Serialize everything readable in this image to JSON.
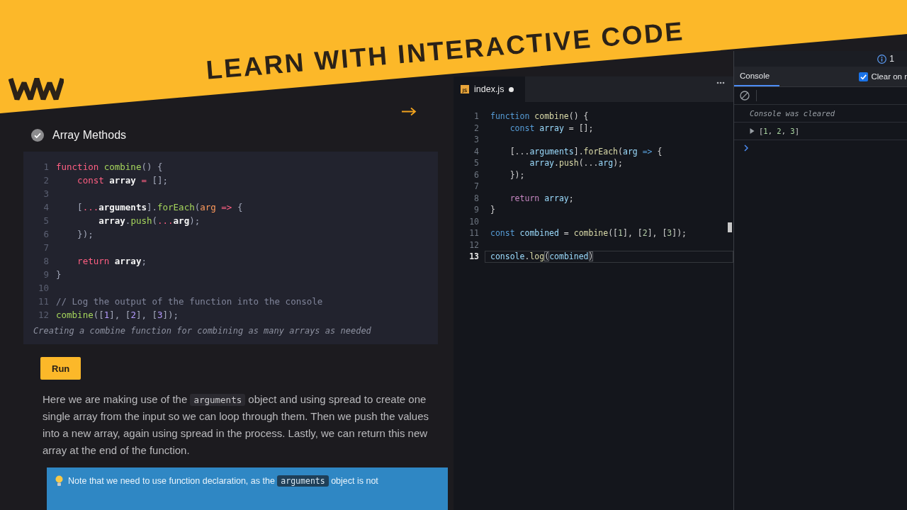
{
  "banner": {
    "title": "LEARN WITH INTERACTIVE CODE"
  },
  "lesson": {
    "title": "Array Methods",
    "completed": true,
    "code": {
      "lines": [
        {
          "number": "1",
          "tokens": [
            {
              "text": "function ",
              "kind": "keyword"
            },
            {
              "text": "combine",
              "kind": "function"
            },
            {
              "text": "() {",
              "kind": "punct"
            }
          ]
        },
        {
          "number": "2",
          "tokens": [
            {
              "text": "    const ",
              "kind": "keyword"
            },
            {
              "text": "array",
              "kind": "variable"
            },
            {
              "text": " = ",
              "kind": "operator"
            },
            {
              "text": "[];",
              "kind": "punct"
            }
          ]
        },
        {
          "number": "3"
        },
        {
          "number": "4",
          "tokens": [
            {
              "text": "    [",
              "kind": "punct"
            },
            {
              "text": "...",
              "kind": "operator"
            },
            {
              "text": "arguments",
              "kind": "variable"
            },
            {
              "text": "].",
              "kind": "punct"
            },
            {
              "text": "forEach",
              "kind": "function"
            },
            {
              "text": "(",
              "kind": "punct"
            },
            {
              "text": "arg",
              "kind": "param"
            },
            {
              "text": " => ",
              "kind": "operator"
            },
            {
              "text": "{",
              "kind": "punct"
            }
          ]
        },
        {
          "number": "5",
          "tokens": [
            {
              "text": "        array",
              "kind": "variable"
            },
            {
              "text": ".",
              "kind": "punct"
            },
            {
              "text": "push",
              "kind": "function"
            },
            {
              "text": "(",
              "kind": "punct"
            },
            {
              "text": "...",
              "kind": "operator"
            },
            {
              "text": "arg",
              "kind": "variable"
            },
            {
              "text": ");",
              "kind": "punct"
            }
          ]
        },
        {
          "number": "6",
          "tokens": [
            {
              "text": "    });",
              "kind": "punct"
            }
          ]
        },
        {
          "number": "7"
        },
        {
          "number": "8",
          "tokens": [
            {
              "text": "    return ",
              "kind": "keyword"
            },
            {
              "text": "array",
              "kind": "variable"
            },
            {
              "text": ";",
              "kind": "punct"
            }
          ]
        },
        {
          "number": "9",
          "tokens": [
            {
              "text": "}",
              "kind": "punct"
            }
          ]
        },
        {
          "number": "10"
        },
        {
          "number": "11",
          "tokens": [
            {
              "text": "// Log the output of the function into the console",
              "kind": "comment"
            }
          ]
        },
        {
          "number": "12",
          "tokens": [
            {
              "text": "combine",
              "kind": "function"
            },
            {
              "text": "([",
              "kind": "punct"
            },
            {
              "text": "1",
              "kind": "number"
            },
            {
              "text": "], [",
              "kind": "punct"
            },
            {
              "text": "2",
              "kind": "number"
            },
            {
              "text": "], [",
              "kind": "punct"
            },
            {
              "text": "3",
              "kind": "number"
            },
            {
              "text": "]);",
              "kind": "punct"
            }
          ]
        }
      ],
      "caption": "Creating a combine function for combining as many arrays as needed"
    },
    "run_button": "Run",
    "paragraph": [
      {
        "text": "Here we are making use of the ",
        "kind": "text"
      },
      {
        "text": "arguments",
        "kind": "code"
      },
      {
        "text": " object and using spread to create one single array from the input so we can loop through them. Then we push the values into a new array, again using spread in the process. Lastly, we can return this new array at the end of the function.",
        "kind": "text"
      }
    ],
    "note": [
      {
        "text": "Note that we need to use function declaration, as the ",
        "kind": "text"
      },
      {
        "text": "arguments",
        "kind": "code"
      },
      {
        "text": " object is not",
        "kind": "text"
      }
    ]
  },
  "editor": {
    "tabs": [
      {
        "label": "index.js",
        "badge": "JS",
        "selected": true,
        "modified": true
      }
    ],
    "lines": [
      {
        "number": "1",
        "current": false,
        "tokens": [
          {
            "text": "function ",
            "kind": "keyword"
          },
          {
            "text": "combine",
            "kind": "function"
          },
          {
            "text": "() {",
            "kind": "punct"
          }
        ]
      },
      {
        "number": "2",
        "current": false,
        "tokens": [
          {
            "text": "    const ",
            "kind": "keyword"
          },
          {
            "text": "array",
            "kind": "variable"
          },
          {
            "text": " = [];",
            "kind": "punct"
          }
        ]
      },
      {
        "number": "3",
        "current": false
      },
      {
        "number": "4",
        "current": false,
        "tokens": [
          {
            "text": "    [...",
            "kind": "punct"
          },
          {
            "text": "arguments",
            "kind": "variable"
          },
          {
            "text": "].",
            "kind": "punct"
          },
          {
            "text": "forEach",
            "kind": "function"
          },
          {
            "text": "(",
            "kind": "punct"
          },
          {
            "text": "arg",
            "kind": "variable"
          },
          {
            "text": " => ",
            "kind": "keyword"
          },
          {
            "text": "{",
            "kind": "punct"
          }
        ]
      },
      {
        "number": "5",
        "current": false,
        "tokens": [
          {
            "text": "        array",
            "kind": "variable"
          },
          {
            "text": ".",
            "kind": "punct"
          },
          {
            "text": "push",
            "kind": "function"
          },
          {
            "text": "(...",
            "kind": "punct"
          },
          {
            "text": "arg",
            "kind": "variable"
          },
          {
            "text": ");",
            "kind": "punct"
          }
        ]
      },
      {
        "number": "6",
        "current": false,
        "tokens": [
          {
            "text": "    });",
            "kind": "punct"
          }
        ]
      },
      {
        "number": "7",
        "current": false
      },
      {
        "number": "8",
        "current": false,
        "tokens": [
          {
            "text": "    return ",
            "kind": "control"
          },
          {
            "text": "array",
            "kind": "variable"
          },
          {
            "text": ";",
            "kind": "punct"
          }
        ]
      },
      {
        "number": "9",
        "current": false,
        "tokens": [
          {
            "text": "}",
            "kind": "punct"
          }
        ]
      },
      {
        "number": "10",
        "current": false
      },
      {
        "number": "11",
        "current": false,
        "tokens": [
          {
            "text": "const ",
            "kind": "keyword"
          },
          {
            "text": "combined",
            "kind": "variable"
          },
          {
            "text": " = ",
            "kind": "punct"
          },
          {
            "text": "combine",
            "kind": "function"
          },
          {
            "text": "([",
            "kind": "punct"
          },
          {
            "text": "1",
            "kind": "number"
          },
          {
            "text": "], [",
            "kind": "punct"
          },
          {
            "text": "2",
            "kind": "number"
          },
          {
            "text": "], [",
            "kind": "punct"
          },
          {
            "text": "3",
            "kind": "number"
          },
          {
            "text": "]);",
            "kind": "punct"
          }
        ]
      },
      {
        "number": "12",
        "current": false
      },
      {
        "number": "13",
        "current": true,
        "tokens": [
          {
            "text": "console",
            "kind": "variable"
          },
          {
            "text": ".",
            "kind": "punct"
          },
          {
            "text": "log",
            "kind": "function"
          },
          {
            "text": "(",
            "kind": "bracket"
          },
          {
            "text": "combined",
            "kind": "variable"
          },
          {
            "text": ")",
            "kind": "bracket"
          }
        ]
      }
    ]
  },
  "console": {
    "info_count": "1",
    "tabs": [
      {
        "label": "Console",
        "selected": true
      }
    ],
    "clear_option": {
      "label": "Clear on r",
      "checked": true
    },
    "messages": [
      {
        "kind": "info",
        "text": "Console was cleared"
      },
      {
        "kind": "value",
        "expanded": false,
        "tokens": [
          {
            "text": "[",
            "kind": "punct"
          },
          {
            "text": "1",
            "kind": "number"
          },
          {
            "text": ", ",
            "kind": "punct"
          },
          {
            "text": "2",
            "kind": "number"
          },
          {
            "text": ", ",
            "kind": "punct"
          },
          {
            "text": "3",
            "kind": "number"
          },
          {
            "text": "]",
            "kind": "punct"
          }
        ]
      }
    ]
  }
}
